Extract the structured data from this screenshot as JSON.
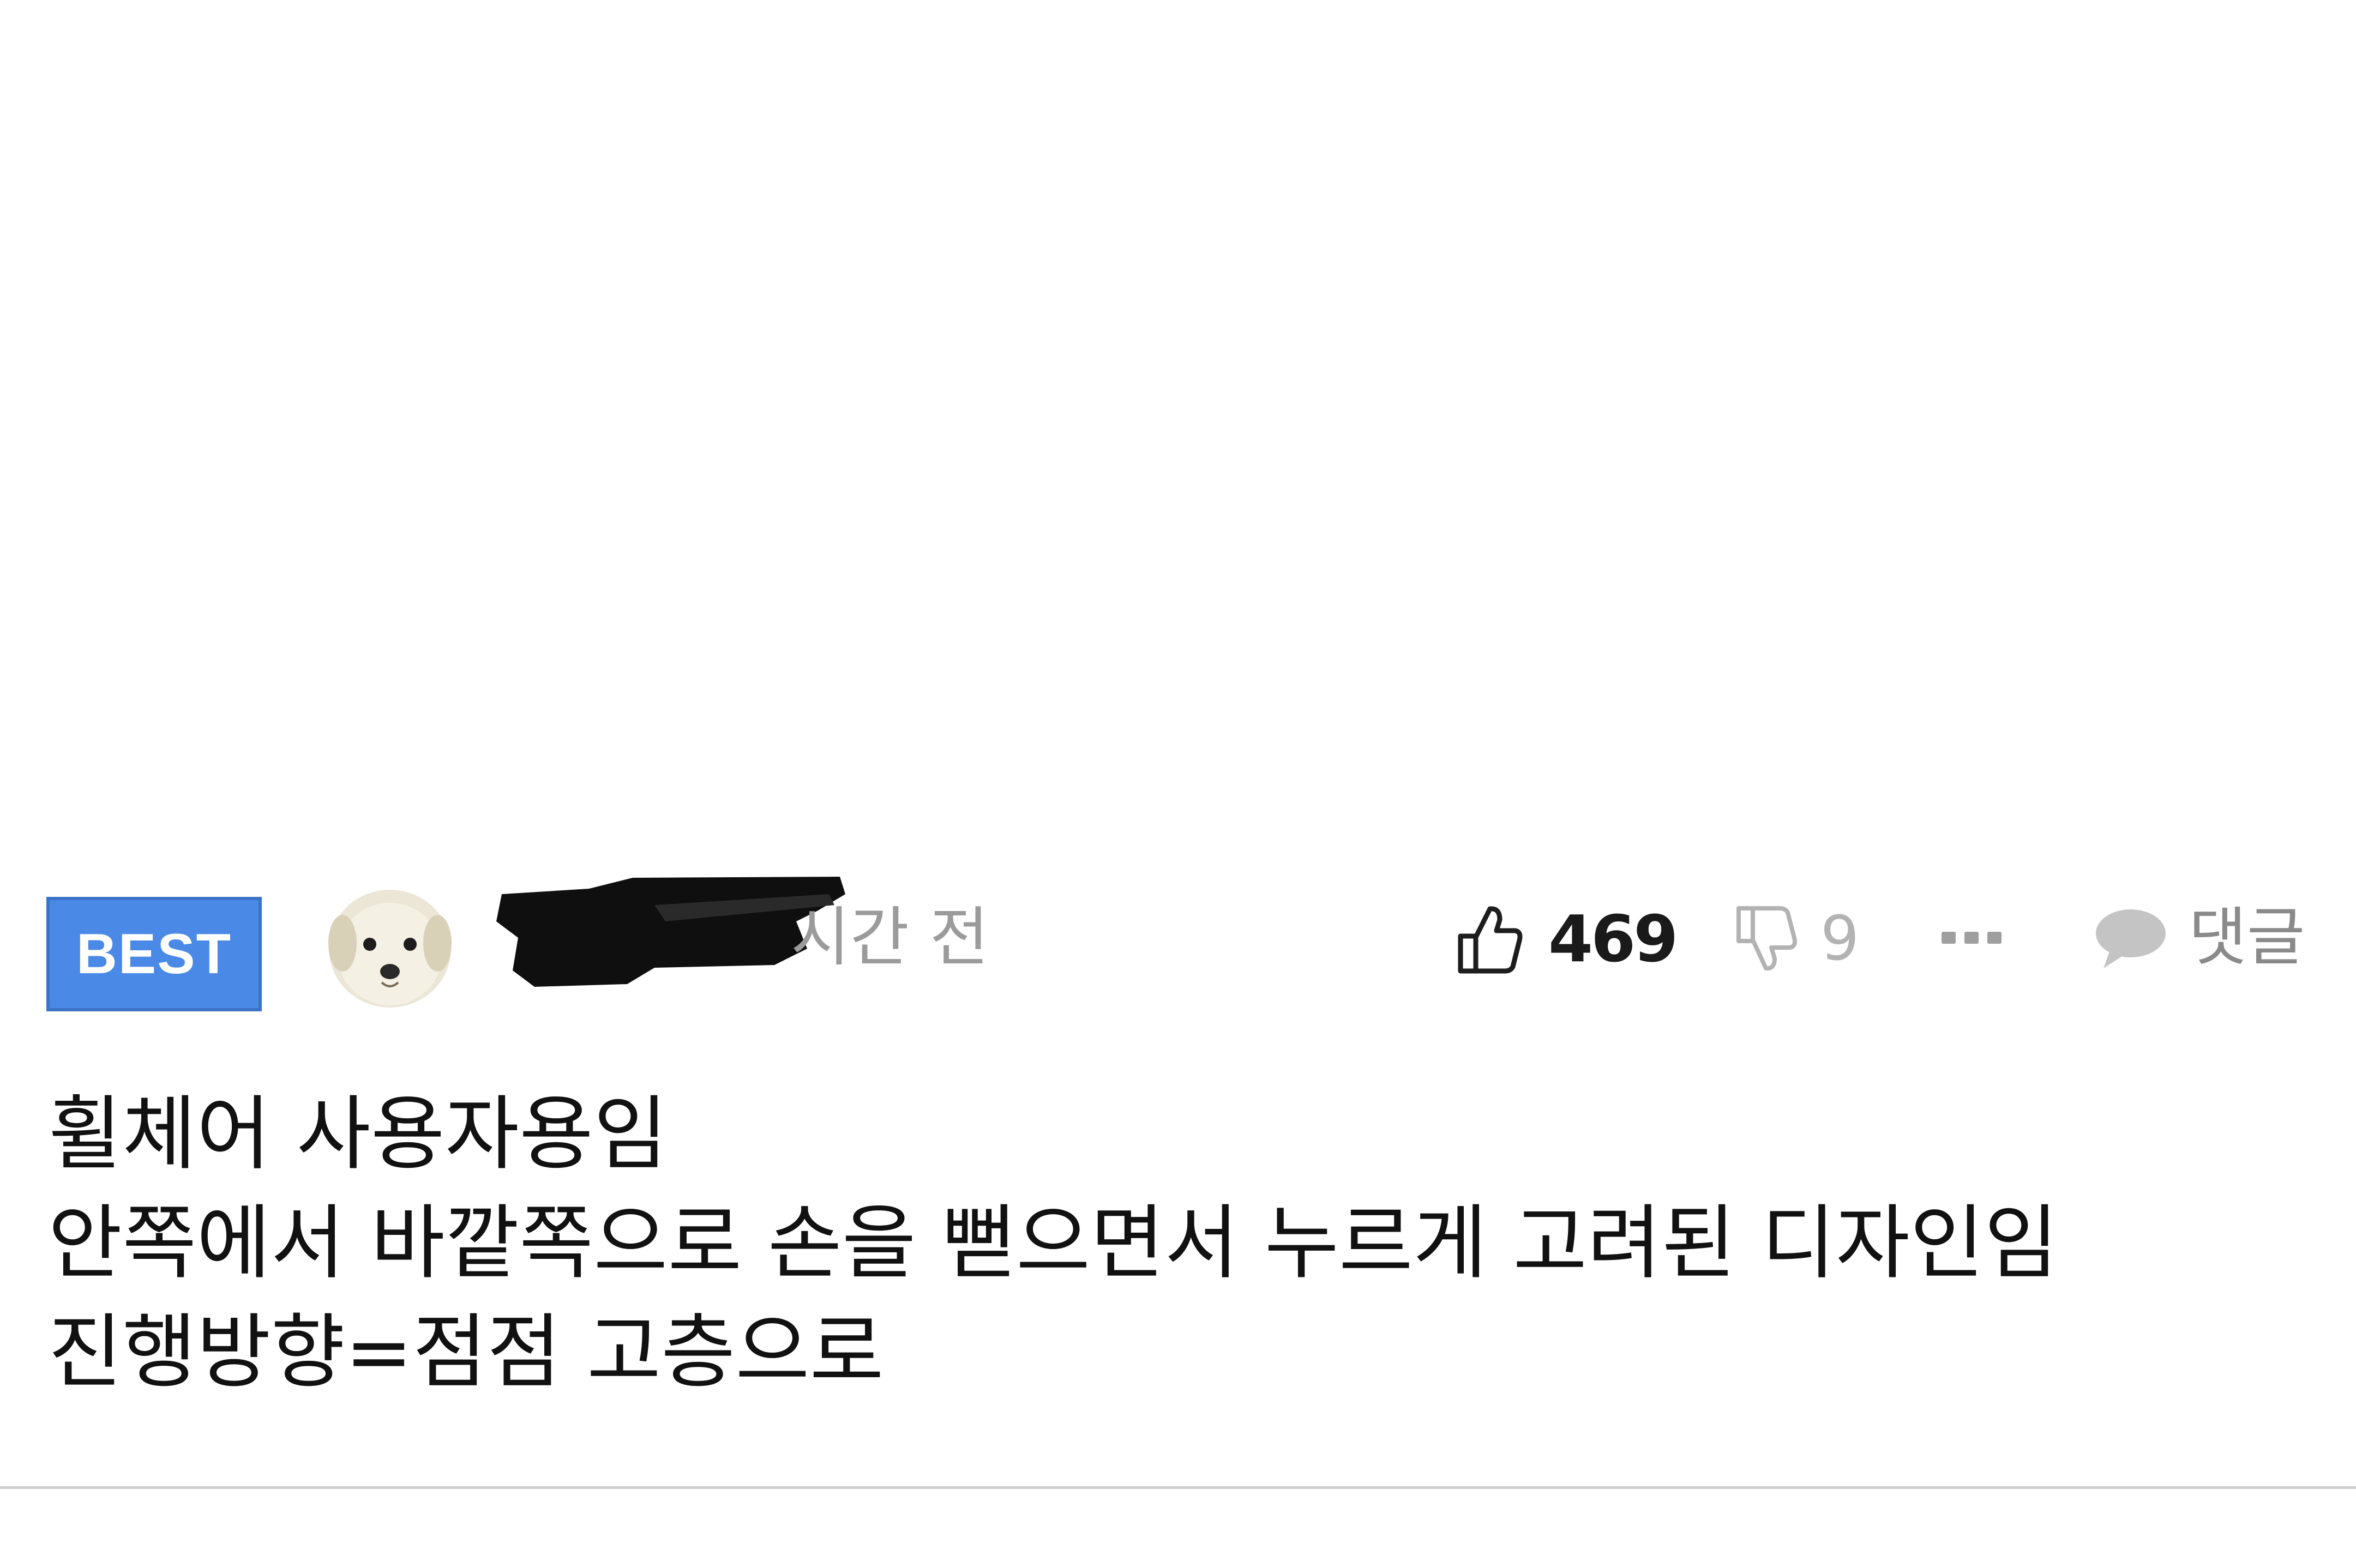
{
  "comment": {
    "badge": "BEST",
    "time_suffix": "시간 전",
    "likes": "469",
    "dislikes": "9",
    "reply_label": "댓글",
    "body_lines": [
      "휠체어 사용자용임",
      "안쪽에서 바깥쪽으로 손을 뻗으면서 누르게 고려된 디자인임",
      "진행방향=점점 고층으로"
    ]
  },
  "icons": {
    "avatar": "puppy-avatar-icon",
    "like": "thumbs-up-icon",
    "dislike": "thumbs-down-icon",
    "more": "more-dots-icon",
    "reply": "speech-bubble-icon"
  },
  "colors": {
    "badge_background": "#4a8ae6",
    "muted_text": "#9b9b9b",
    "body_text": "#111111"
  }
}
